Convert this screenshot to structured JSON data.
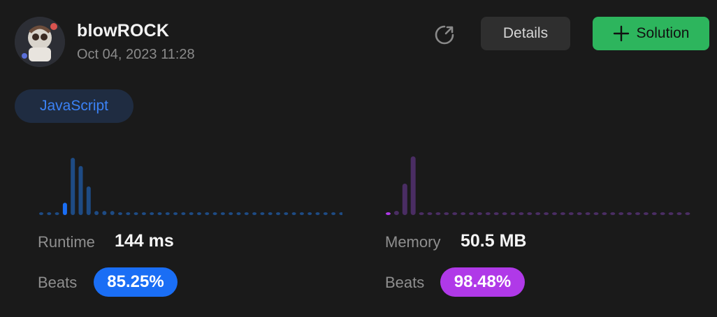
{
  "header": {
    "username": "blowROCK",
    "timestamp": "Oct 04, 2023 11:28",
    "details_label": "Details",
    "solution_label": "Solution"
  },
  "language": "JavaScript",
  "runtime": {
    "label": "Runtime",
    "value": "144 ms",
    "beats_label": "Beats",
    "beats_value": "85.25%",
    "color": "#1a6ef5"
  },
  "memory": {
    "label": "Memory",
    "value": "50.5 MB",
    "beats_label": "Beats",
    "beats_value": "98.48%",
    "color": "#b039e8"
  },
  "chart_data": [
    {
      "type": "bar",
      "name": "runtime-distribution",
      "values": [
        0.5,
        0.5,
        0.5,
        3,
        14,
        12,
        7,
        1,
        1,
        1,
        0.5,
        0.5,
        0.5,
        0.5,
        0.5,
        0.5,
        0.5,
        0.5,
        0.5,
        0.5,
        0.5,
        0.5,
        0.5,
        0.5,
        0.5,
        0.5,
        0.5,
        0.5,
        0.5,
        0.5,
        0.5,
        0.5,
        0.5,
        0.5,
        0.5,
        0.5,
        0.5,
        0.5,
        0.5
      ],
      "highlight_index": 3,
      "color": "#1e4b84",
      "highlight_color": "#1a6ef5",
      "ymax": 14
    },
    {
      "type": "bar",
      "name": "memory-distribution",
      "values": [
        0.5,
        1,
        7.5,
        14,
        0.5,
        0.5,
        0.5,
        0.5,
        0.5,
        0.5,
        0.5,
        0.5,
        0.5,
        0.5,
        0.5,
        0.5,
        0.5,
        0.5,
        0.5,
        0.5,
        0.5,
        0.5,
        0.5,
        0.5,
        0.5,
        0.5,
        0.5,
        0.5,
        0.5,
        0.5,
        0.5,
        0.5,
        0.5,
        0.5,
        0.5,
        0.5,
        0.5
      ],
      "highlight_index": 0,
      "color": "#4a2d63",
      "highlight_color": "#b039e8",
      "ymax": 14
    }
  ]
}
